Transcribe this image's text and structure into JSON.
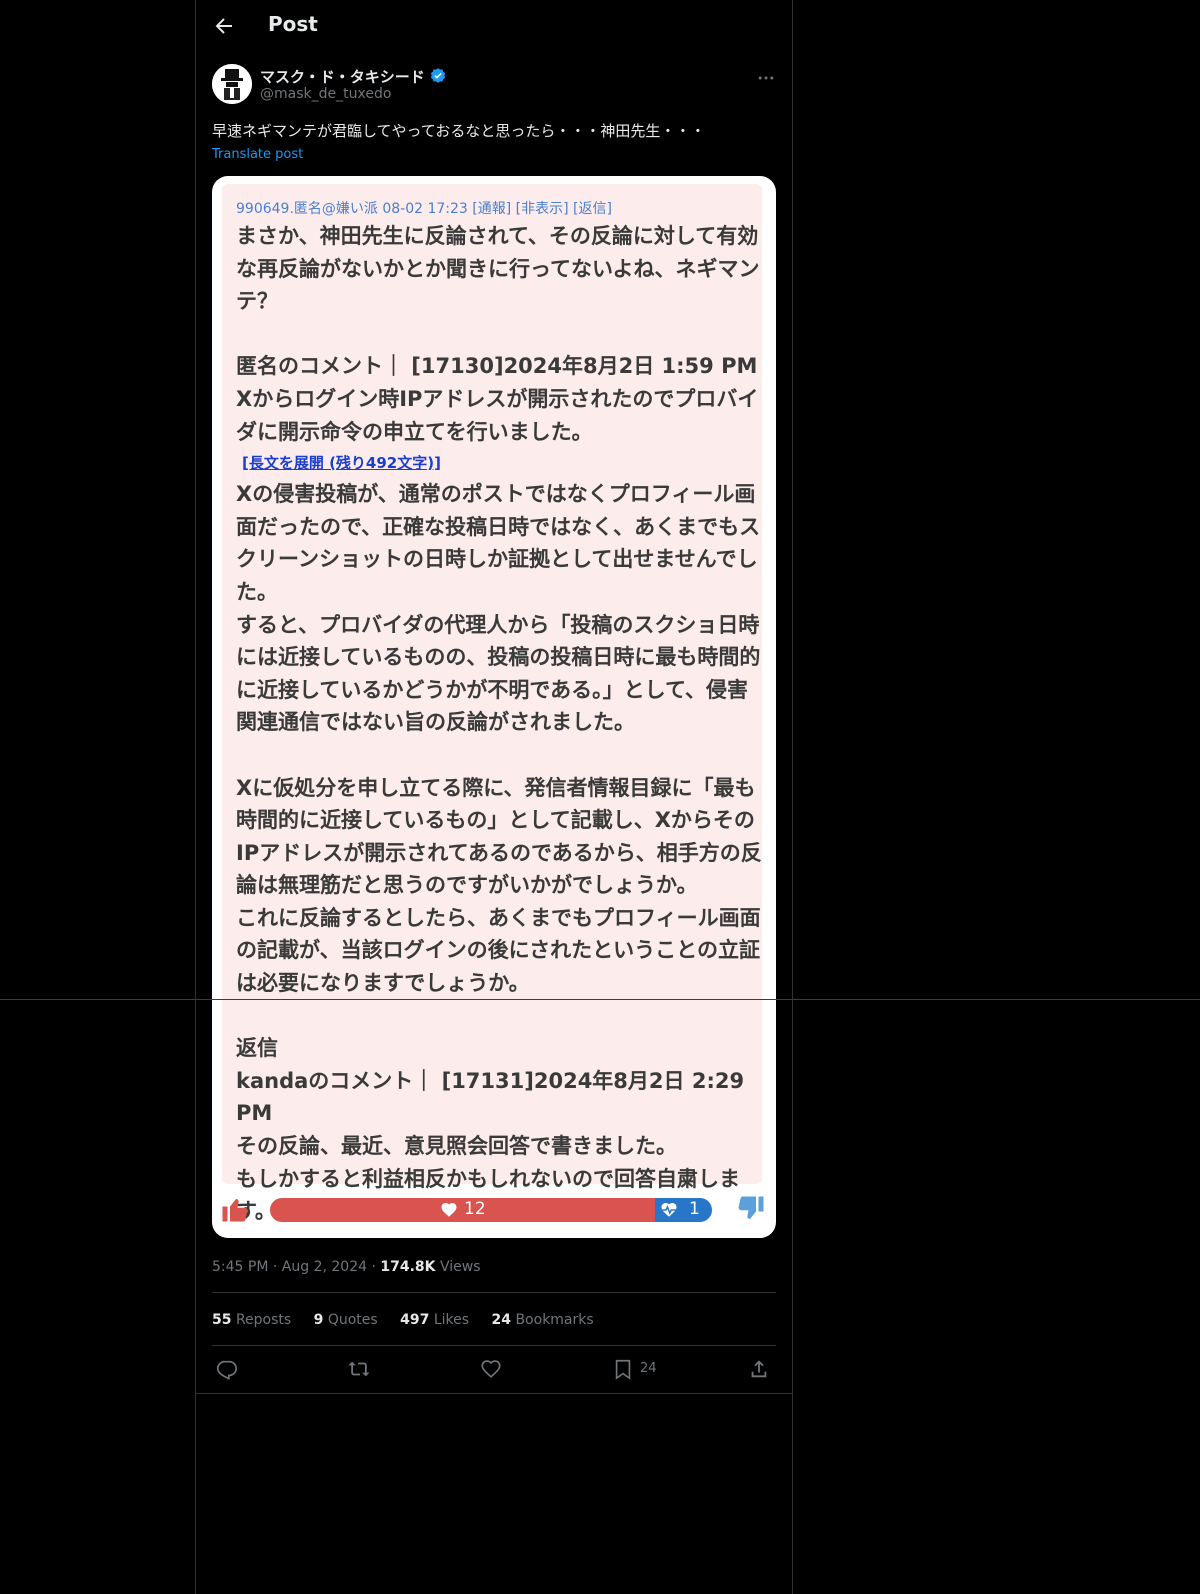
{
  "header": {
    "title": "Post"
  },
  "author": {
    "name": "マスク・ド・タキシード",
    "handle": "@mask_de_tuxedo"
  },
  "tweet": {
    "text": "早速ネギマンテが君臨してやっておるなと思ったら・・・神田先生・・・",
    "translate_label": "Translate post"
  },
  "screenshot": {
    "meta": "990649.匿名@嫌い派 08-02 17:23  [通報]  [非表示]  [返信]",
    "lines": [
      "まさか、神田先生に反論されて、その反論に対して有効な再反論がないかとか聞きに行ってないよね、ネギマンテ？",
      "匿名のコメント｜ [17130]2024年8月2日 1:59 PM",
      "Xからログイン時IPアドレスが開示されたのでプロバイダに開示命令の申立てを行いました。",
      "[長文を展開 (残り492文字)]",
      "Xの侵害投稿が、通常のポストではなくプロフィール画面だったので、正確な投稿日時ではなく、あくまでもスクリーンショットの日時しか証拠として出せませんでした。",
      "すると、プロバイダの代理人から「投稿のスクショ日時には近接しているものの、投稿の投稿日時に最も時間的に近接しているかどうかが不明である。」として、侵害関連通信ではない旨の反論がされました。",
      "Xに仮処分を申し立てる際に、発信者情報目録に「最も時間的に近接しているもの」として記載し、Xからその IPアドレスが開示されてあるのであるから、相手方の反論は無理筋だと思うのですがいかがでしょうか。",
      "これに反論するとしたら、あくまでもプロフィール画面の記載が、当該ログインの後にされたということの立証は必要になりますでしょうか。",
      "返信",
      "kandaのコメント｜ [17131]2024年8月2日 2:29 PM",
      "その反論、最近、意見照会回答で書きました。",
      "もしかすると利益相反かもしれないので回答自粛します。"
    ],
    "votes": {
      "likes": "12",
      "dislikes": "1",
      "like_fraction": 0.87
    }
  },
  "footer": {
    "time": "5:45 PM",
    "date": "Aug 2, 2024",
    "views_count": "174.8K",
    "views_label": "Views",
    "stats": [
      {
        "count": "55",
        "label": "Reposts"
      },
      {
        "count": "9",
        "label": "Quotes"
      },
      {
        "count": "497",
        "label": "Likes"
      },
      {
        "count": "24",
        "label": "Bookmarks"
      }
    ],
    "bookmark_count": "24"
  },
  "colors": {
    "background": "#000000",
    "accent": "#1d9bf0",
    "secondary_text": "#71767b",
    "screenshot_bg": "#fdecec",
    "like_bar": "#d9534f",
    "dislike_bar": "#2876c8"
  }
}
